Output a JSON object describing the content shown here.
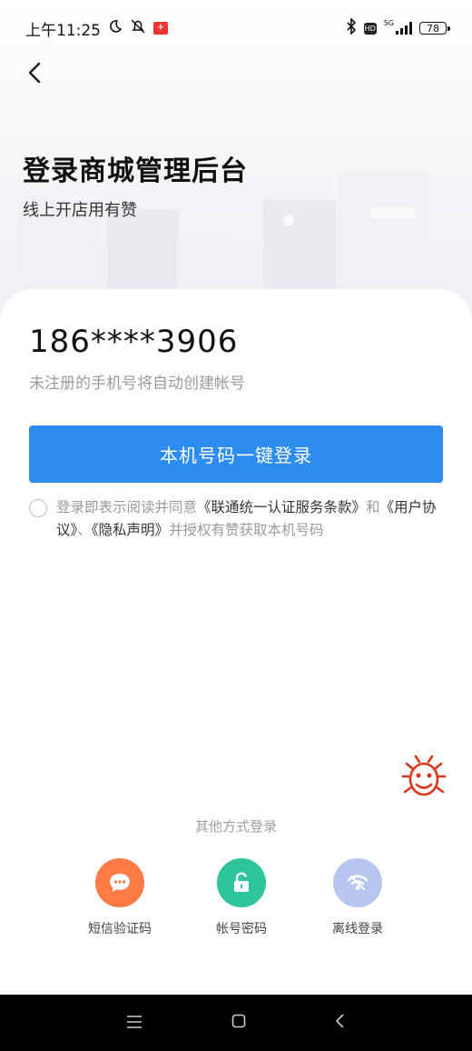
{
  "status": {
    "time": "上午11:25",
    "network_label": "5G",
    "battery": "78"
  },
  "header": {
    "title": "登录商城管理后台",
    "subtitle": "线上开店用有赞"
  },
  "login": {
    "phone": "186****3906",
    "hint": "未注册的手机号将自动创建帐号",
    "one_key_button": "本机号码一键登录"
  },
  "agreement": {
    "prefix": "登录即表示阅读并同意",
    "link1": "《联通统一认证服务条款》",
    "and": "和",
    "link2": "《用户协议》",
    "sep": "、",
    "link3": "《隐私声明》",
    "suffix": "并授权有赞获取本机号码"
  },
  "other_methods": {
    "title": "其他方式登录",
    "options": [
      {
        "label": "短信验证码",
        "icon": "chat-bubble-icon",
        "color": "#ff7a45"
      },
      {
        "label": "帐号密码",
        "icon": "unlock-icon",
        "color": "#2fc59b"
      },
      {
        "label": "离线登录",
        "icon": "wifi-offline-icon",
        "color": "#b7c6ef"
      }
    ]
  },
  "colors": {
    "primary": "#2d8cf0",
    "bug_icon": "#d9381e",
    "navbar": "#000000"
  }
}
